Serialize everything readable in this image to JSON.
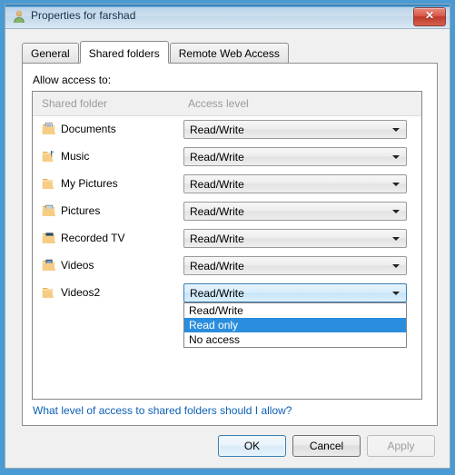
{
  "window": {
    "title": "Properties for farshad",
    "icon": "user-icon",
    "close_label": "✕",
    "frame_color": "#4a9ad4"
  },
  "tabs": [
    {
      "label": "General",
      "selected": false
    },
    {
      "label": "Shared folders",
      "selected": true
    },
    {
      "label": "Remote Web Access",
      "selected": false
    }
  ],
  "page": {
    "allow_label": "Allow access to:",
    "columns": {
      "folder": "Shared folder",
      "access": "Access level"
    },
    "rows": [
      {
        "name": "Documents",
        "icon": "folder-documents-icon",
        "access": "Read/Write",
        "open": false
      },
      {
        "name": "Music",
        "icon": "folder-music-icon",
        "access": "Read/Write",
        "open": false
      },
      {
        "name": "My Pictures",
        "icon": "folder-plain-icon",
        "access": "Read/Write",
        "open": false
      },
      {
        "name": "Pictures",
        "icon": "folder-pictures-icon",
        "access": "Read/Write",
        "open": false
      },
      {
        "name": "Recorded TV",
        "icon": "folder-tv-icon",
        "access": "Read/Write",
        "open": false
      },
      {
        "name": "Videos",
        "icon": "folder-video-icon",
        "access": "Read/Write",
        "open": false
      },
      {
        "name": "Videos2",
        "icon": "folder-plain-icon",
        "access": "Read/Write",
        "open": true
      }
    ],
    "dropdown_options": [
      {
        "label": "Read/Write",
        "selected": false
      },
      {
        "label": "Read only",
        "selected": true
      },
      {
        "label": "No access",
        "selected": false
      }
    ],
    "help_link": "What level of access to shared folders should I allow?"
  },
  "buttons": {
    "ok": "OK",
    "cancel": "Cancel",
    "apply": "Apply"
  },
  "colors": {
    "highlight": "#2a8ddd",
    "link": "#0c5fb5",
    "header_text": "#9a9a9a"
  }
}
